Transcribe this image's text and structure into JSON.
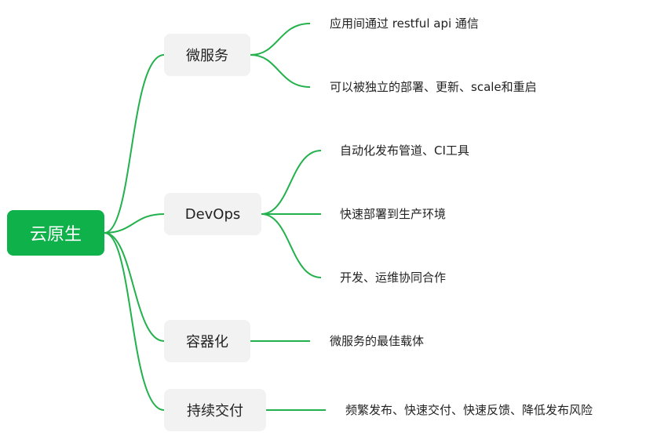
{
  "root": {
    "label": "云原生"
  },
  "branches": [
    {
      "label": "微服务",
      "leaves": [
        "应用间通过 restful api 通信",
        "可以被独立的部署、更新、scale和重启"
      ]
    },
    {
      "label": "DevOps",
      "leaves": [
        "自动化发布管道、CI工具",
        "快速部署到生产环境",
        "开发、运维协同合作"
      ]
    },
    {
      "label": "容器化",
      "leaves": [
        "微服务的最佳载体"
      ]
    },
    {
      "label": "持续交付",
      "leaves": [
        "频繁发布、快速交付、快速反馈、降低发布风险"
      ]
    }
  ],
  "colors": {
    "root_fill": "#0fb14a",
    "connector": "#22b14c",
    "branch_fill": "#f2f2f2"
  }
}
